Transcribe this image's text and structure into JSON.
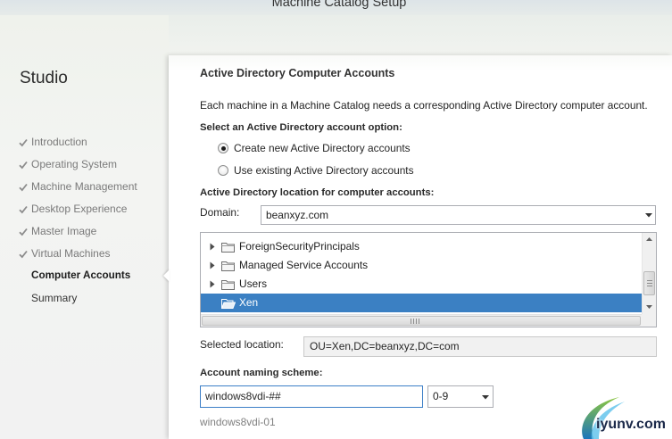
{
  "window": {
    "title": "Machine Catalog Setup"
  },
  "sidebar": {
    "app_title": "Studio",
    "steps": [
      {
        "label": "Introduction",
        "completed": true,
        "current": false
      },
      {
        "label": "Operating System",
        "completed": true,
        "current": false
      },
      {
        "label": "Machine Management",
        "completed": true,
        "current": false
      },
      {
        "label": "Desktop Experience",
        "completed": true,
        "current": false
      },
      {
        "label": "Master Image",
        "completed": true,
        "current": false
      },
      {
        "label": "Virtual Machines",
        "completed": true,
        "current": false
      },
      {
        "label": "Computer Accounts",
        "completed": false,
        "current": true
      },
      {
        "label": "Summary",
        "completed": false,
        "current": false
      }
    ]
  },
  "main": {
    "heading": "Active Directory Computer Accounts",
    "description": "Each machine in a Machine Catalog needs a corresponding Active Directory computer account.",
    "account_option": {
      "label": "Select an Active Directory account option:",
      "options": [
        {
          "label": "Create new Active Directory accounts",
          "selected": true
        },
        {
          "label": "Use existing Active Directory accounts",
          "selected": false
        }
      ]
    },
    "location": {
      "label": "Active Directory location for computer accounts:",
      "domain_label": "Domain:",
      "domain_value": "beanxyz.com",
      "tree_items": [
        {
          "label": "ForeignSecurityPrincipals",
          "expandable": true,
          "selected": false
        },
        {
          "label": "Managed Service Accounts",
          "expandable": true,
          "selected": false
        },
        {
          "label": "Users",
          "expandable": true,
          "selected": false
        },
        {
          "label": "Xen",
          "expandable": false,
          "selected": true
        }
      ],
      "selected_label": "Selected location:",
      "selected_value": "OU=Xen,DC=beanxyz,DC=com"
    },
    "naming": {
      "label": "Account naming scheme:",
      "scheme_value": "windows8vdi-##",
      "character_type": "0-9",
      "preview": "windows8vdi-01"
    }
  },
  "icons": {
    "completed_step": "check-icon",
    "tree_expand": "expand-arrow-icon",
    "tree_folder": "folder-icon",
    "tree_folder_selected": "folder-open-icon",
    "dropdown": "chevron-down-icon",
    "scroll_up": "scroll-up-arrow-icon",
    "scroll_down": "scroll-down-arrow-icon"
  },
  "colors": {
    "selection": "#3b80c3",
    "focus_border": "#3c7fc7",
    "completed_step_text": "#7a7a7a"
  },
  "watermark": {
    "mark_cn": "运维网",
    "site": "iyunv.com"
  }
}
